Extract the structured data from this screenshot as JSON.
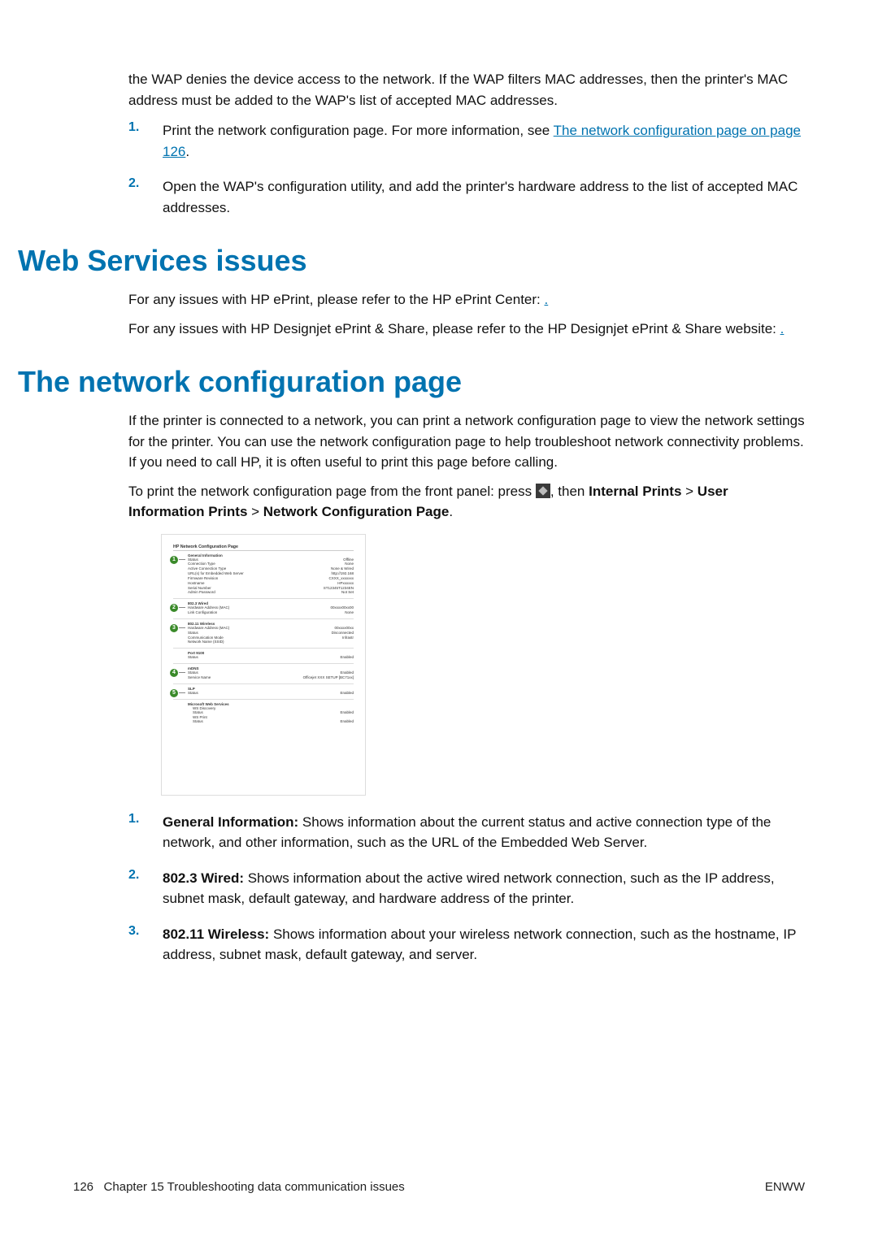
{
  "intro": {
    "wap_paragraph": "the WAP denies the device access to the network. If the WAP filters MAC addresses, then the printer's MAC address must be added to the WAP's list of accepted MAC addresses.",
    "steps": [
      {
        "num": "1.",
        "pre": "Print the network configuration page. For more information, see ",
        "link": "The network configuration page on page 126",
        "post": "."
      },
      {
        "num": "2.",
        "text": "Open the WAP's configuration utility, and add the printer's hardware address to the list of accepted MAC addresses."
      }
    ]
  },
  "webservices": {
    "heading": "Web Services issues",
    "p1_pre": "For any issues with HP ePrint, please refer to the HP ePrint Center: ",
    "p1_link": ".",
    "p2_pre": "For any issues with HP Designjet ePrint & Share, please refer to the HP Designjet ePrint & Share website: ",
    "p2_link": "."
  },
  "netconfig": {
    "heading": "The network configuration page",
    "p1": "If the printer is connected to a network, you can print a network configuration page to view the network settings for the printer. You can use the network configuration page to help troubleshoot network connectivity problems. If you need to call HP, it is often useful to print this page before calling.",
    "p2_pre": "To print the network configuration page from the front panel: press ",
    "p2_mid": ", then ",
    "p2_b1": "Internal Prints",
    "p2_gt1": " > ",
    "p2_b2": "User Information Prints",
    "p2_gt2": " > ",
    "p2_b3": "Network Configuration Page",
    "p2_end": ".",
    "sample": {
      "title": "HP Network Configuration Page",
      "s1h": "General Information",
      "s1": [
        [
          "Status",
          "Offline"
        ],
        [
          "Connection Type",
          "None"
        ],
        [
          "Active Connection Type",
          "None & Wired"
        ],
        [
          "URL(s) for Embedded Web Server",
          "http://192.168"
        ],
        [
          "Firmware Revision",
          "CXXX_xxxxxxx"
        ],
        [
          "Hostname",
          "HPxxxxxx"
        ],
        [
          "Serial Number",
          "ST12345T1234EN"
        ],
        [
          "Admin Password",
          "Not Set"
        ]
      ],
      "s2h": "802.3 Wired",
      "s2": [
        [
          "Hardware Address (MAC)",
          "00xxxx00xx00"
        ],
        [
          "Link Configuration",
          "None"
        ]
      ],
      "s3h": "802.11 Wireless",
      "s3": [
        [
          "Hardware Address (MAC)",
          "00xxxx00xx"
        ],
        [
          "Status",
          "Disconnected"
        ],
        [
          "Communication Mode",
          "Infrastr"
        ],
        [
          "Network Name (SSID)",
          ""
        ]
      ],
      "s_port": "Port 9100",
      "sp_row": [
        "Status",
        "Enabled"
      ],
      "s4h": "mDNS",
      "s4": [
        [
          "Status",
          "Enabled"
        ],
        [
          "Service Name",
          "Officejet XXX SETUP [BC71xx]"
        ]
      ],
      "s5h": "SLP",
      "s5": [
        [
          "Status",
          "Enabled"
        ]
      ],
      "s6h": "Microsoft Web Services",
      "s6a": "WS Discovery",
      "s6ai": [
        [
          "Status",
          "Enabled"
        ]
      ],
      "s6b": "WS Print",
      "s6bi": [
        [
          "Status",
          "Enabled"
        ]
      ]
    },
    "items": [
      {
        "num": "1.",
        "lead": "General Information:",
        "text": " Shows information about the current status and active connection type of the network, and other information, such as the URL of the Embedded Web Server."
      },
      {
        "num": "2.",
        "lead": "802.3 Wired:",
        "text": " Shows information about the active wired network connection, such as the IP address, subnet mask, default gateway, and hardware address of the printer."
      },
      {
        "num": "3.",
        "lead": "802.11 Wireless:",
        "text": " Shows information about your wireless network connection, such as the hostname, IP address, subnet mask, default gateway, and server."
      }
    ]
  },
  "footer": {
    "pagenum": "126",
    "chapter": "Chapter 15   Troubleshooting data communication issues",
    "right": "ENWW"
  }
}
